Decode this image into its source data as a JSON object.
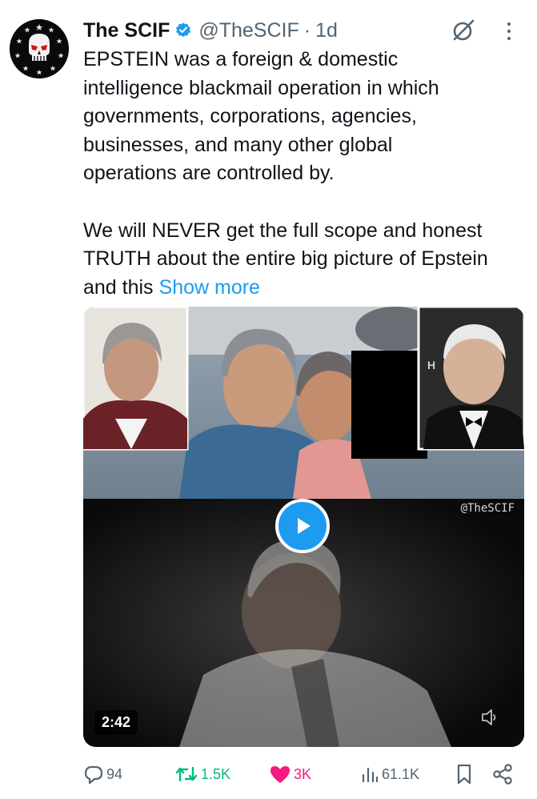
{
  "tweet": {
    "author_name": "The SCIF",
    "handle": "@TheSCIF",
    "separator": "·",
    "time": "1d",
    "text": "EPSTEIN was a foreign & domestic\nintelligence blackmail operation in which\ngovernments, corporations, agencies,\nbusinesses, and many other global\noperations are controlled by.\n\nWe will NEVER get the full scope and honest\nTRUTH about the entire big picture of Epstein\nand this ",
    "show_more": "Show more"
  },
  "media": {
    "watermark": "@TheSCIF",
    "duration": "2:42"
  },
  "actions": {
    "replies": "94",
    "reposts": "1.5K",
    "likes": "3K",
    "views": "61.1K"
  },
  "icons": {
    "avatar": "skull-avatar-icon",
    "verified": "verified-badge-icon",
    "grok": "grok-icon",
    "more": "more-dots-icon",
    "play": "play-icon",
    "mute": "speaker-muted-icon",
    "reply": "reply-bubble-icon",
    "repost": "repost-icon",
    "like": "heart-icon",
    "views": "views-chart-icon",
    "bookmark": "bookmark-icon",
    "share": "share-icon"
  },
  "colors": {
    "accent": "#1d9bf0",
    "repost": "#00ba7c",
    "like": "#f91880",
    "muted": "#536471",
    "text": "#0f1419"
  }
}
